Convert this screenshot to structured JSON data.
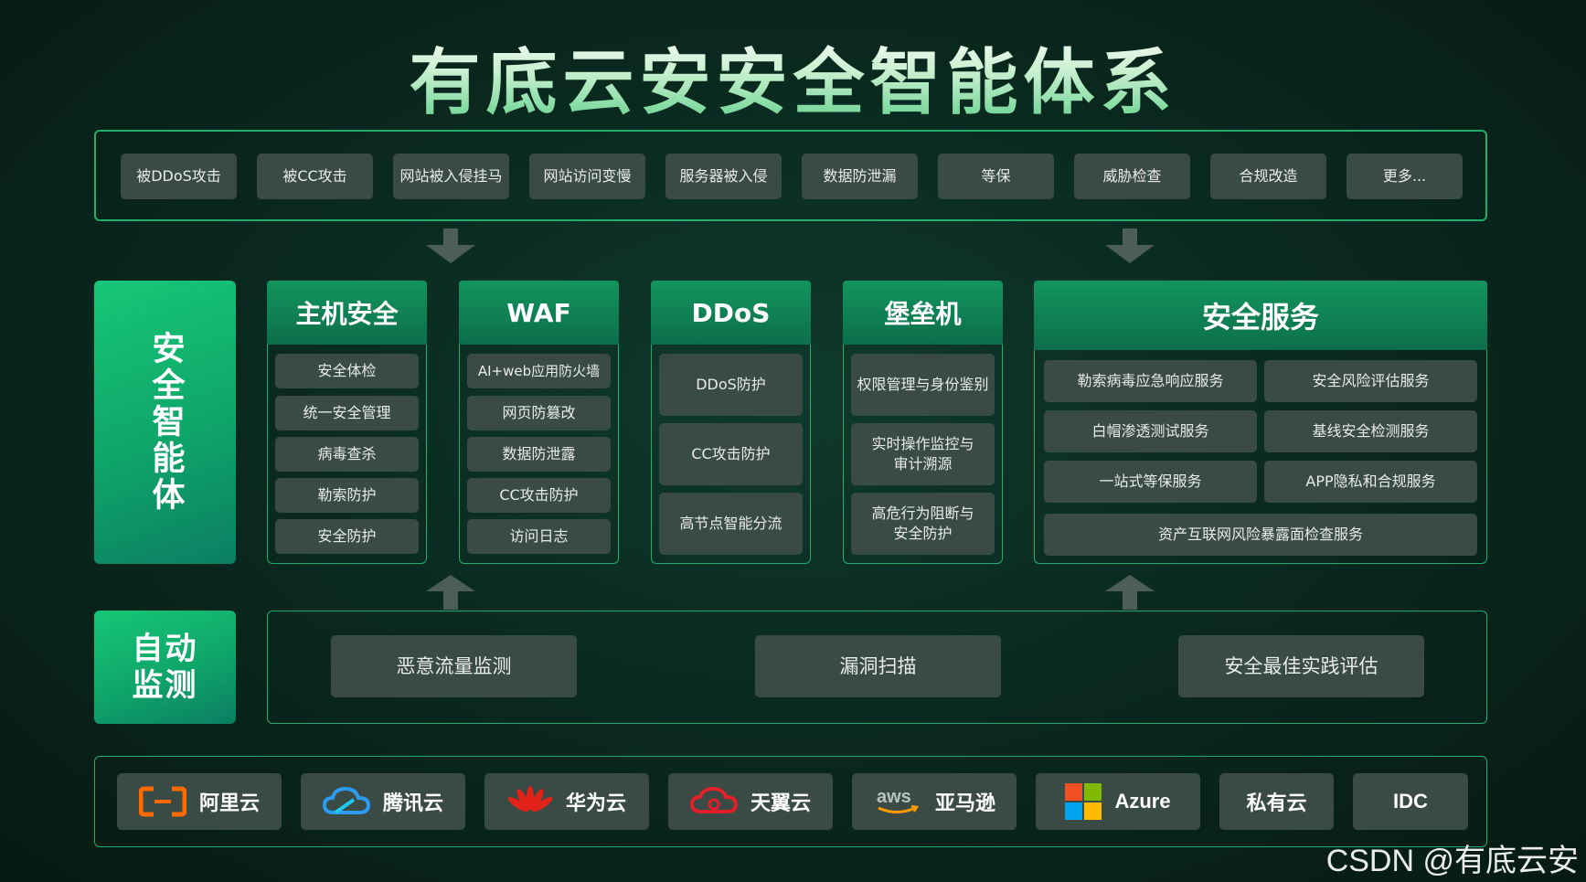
{
  "title": "有底云安安全智能体系",
  "threats": [
    "被DDoS攻击",
    "被CC攻击",
    "网站被入侵挂马",
    "网站访问变慢",
    "服务器被入侵",
    "数据防泄漏",
    "等保",
    "威胁检查",
    "合规改造",
    "更多..."
  ],
  "side_left": "安全智能体",
  "side_monitor": "自动监测",
  "columns": {
    "host": {
      "title": "主机安全",
      "items": [
        "安全体检",
        "统一安全管理",
        "病毒查杀",
        "勒索防护",
        "安全防护"
      ]
    },
    "waf": {
      "title": "WAF",
      "items": [
        "AI+web应用防火墙",
        "网页防篡改",
        "数据防泄露",
        "CC攻击防护",
        "访问日志"
      ]
    },
    "ddos": {
      "title": "DDoS",
      "items": [
        "DDoS防护",
        "CC攻击防护",
        "高节点智能分流"
      ]
    },
    "bastion": {
      "title": "堡垒机",
      "items": [
        "权限管理与身份鉴别",
        "实时操作监控与\n审计溯源",
        "高危行为阻断与\n安全防护"
      ]
    },
    "service": {
      "title": "安全服务",
      "items": [
        "勒索病毒应急响应服务",
        "安全风险评估服务",
        "白帽渗透测试服务",
        "基线安全检测服务",
        "一站式等保服务",
        "APP隐私和合规服务",
        "资产互联网风险暴露面检查服务"
      ]
    }
  },
  "monitor": [
    "恶意流量监测",
    "漏洞扫描",
    "安全最佳实践评估"
  ],
  "clouds": [
    {
      "name": "阿里云",
      "icon": "aliyun-icon"
    },
    {
      "name": "腾讯云",
      "icon": "tencent-cloud-icon"
    },
    {
      "name": "华为云",
      "icon": "huawei-icon"
    },
    {
      "name": "天翼云",
      "icon": "tianyi-icon"
    },
    {
      "name": "亚马逊",
      "icon": "aws-icon"
    },
    {
      "name": "Azure",
      "icon": "microsoft-icon"
    },
    {
      "name": "私有云",
      "icon": ""
    },
    {
      "name": "IDC",
      "icon": ""
    }
  ],
  "watermark": "CSDN @有底云安",
  "colors": {
    "accent": "#1fae6e",
    "chip": "#3a4a44",
    "background": "#0a2a20"
  }
}
